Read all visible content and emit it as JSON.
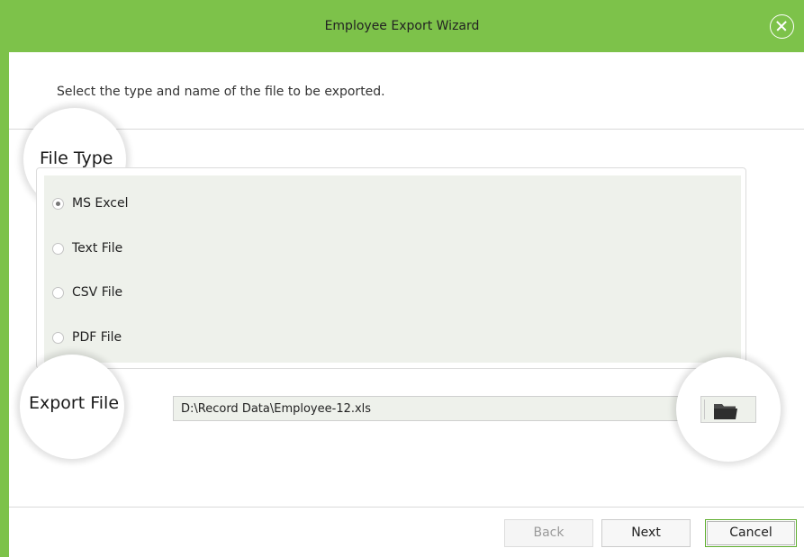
{
  "window": {
    "title": "Employee Export Wizard",
    "close_icon": "close-icon",
    "accent_color": "#7dc24a"
  },
  "instruction": "Select the type and name of the file to be exported.",
  "file_type": {
    "heading": "File Type",
    "options": [
      {
        "label": "MS Excel",
        "selected": true
      },
      {
        "label": "Text File",
        "selected": false
      },
      {
        "label": "CSV File",
        "selected": false
      },
      {
        "label": "PDF File",
        "selected": false
      }
    ]
  },
  "export_file": {
    "heading": "Export File",
    "path": "D:\\Record Data\\Employee-12.xls",
    "browse_icon": "folder-icon"
  },
  "buttons": {
    "back": "Back",
    "next": "Next",
    "cancel": "Cancel"
  }
}
